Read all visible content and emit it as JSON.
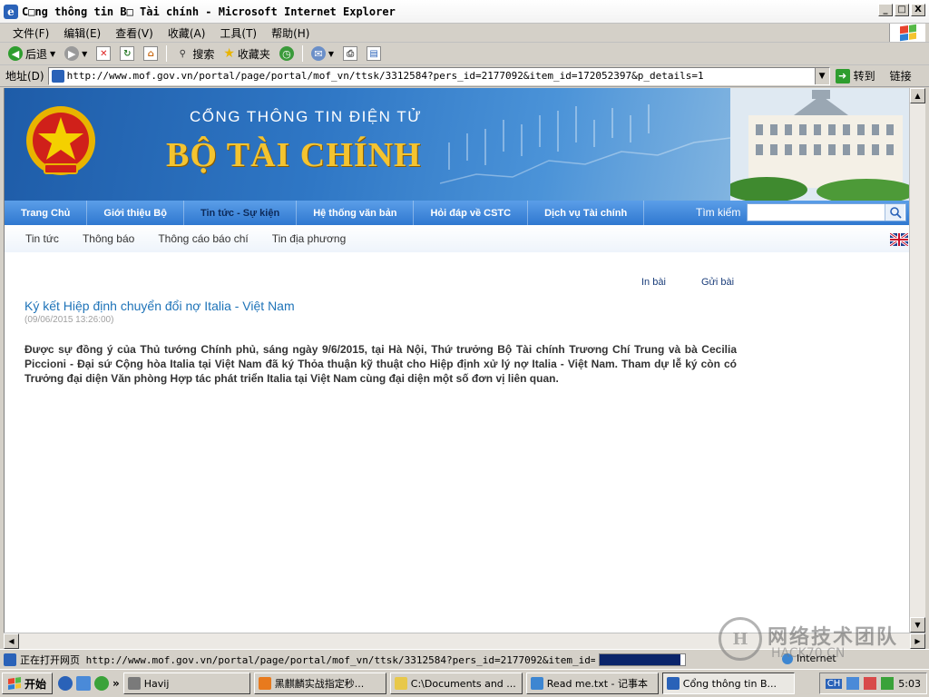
{
  "window": {
    "title": "C□ng thông tin B□ Tài chính - Microsoft Internet Explorer",
    "controls": {
      "minimize": "_",
      "maximize": "□",
      "close": "X"
    }
  },
  "menu": [
    "文件(F)",
    "编辑(E)",
    "查看(V)",
    "收藏(A)",
    "工具(T)",
    "帮助(H)"
  ],
  "toolbar": {
    "back": "后退",
    "search": "搜索",
    "favorites": "收藏夹"
  },
  "address": {
    "label": "地址(D)",
    "url": "http://www.mof.gov.vn/portal/page/portal/mof_vn/ttsk/3312584?pers_id=2177092&item_id=172052397&p_details=1",
    "go": "转到",
    "links": "链接"
  },
  "banner": {
    "subtitle": "CỔNG THÔNG TIN ĐIỆN TỬ",
    "title": "BỘ TÀI CHÍNH"
  },
  "nav": {
    "items": [
      {
        "label": "Trang Chủ",
        "active": false
      },
      {
        "label": "Giới thiệu Bộ",
        "active": false
      },
      {
        "label": "Tin tức - Sự kiện",
        "active": true
      },
      {
        "label": "Hệ thống văn bản",
        "active": false
      },
      {
        "label": "Hỏi đáp về CSTC",
        "active": false
      },
      {
        "label": "Dịch vụ Tài chính",
        "active": false
      }
    ],
    "search_label": "Tìm kiếm"
  },
  "subnav": [
    "Tin tức",
    "Thông báo",
    "Thông cáo báo chí",
    "Tin địa phương"
  ],
  "article": {
    "print": "In bài",
    "send": "Gửi bài",
    "title": "Ký kết Hiệp định chuyển đổi nợ Italia - Việt Nam",
    "date": "(09/06/2015 13:26:00)",
    "body": "Được sự đồng ý của Thủ tướng Chính phủ, sáng ngày 9/6/2015, tại Hà Nội, Thứ trưởng Bộ Tài chính Trương Chí Trung và bà Cecilia Piccioni - Đại sứ Cộng hòa Italia tại Việt Nam đã ký Thỏa thuận kỹ thuật cho Hiệp định xử lý nợ Italia - Việt Nam. Tham dự lễ ký còn có Trưởng đại diện Văn phòng Hợp tác phát triển Italia tại Việt Nam cùng đại diện một số đơn vị liên quan."
  },
  "status": {
    "text": "正在打开网页 http://www.mof.gov.vn/portal/page/portal/mof_vn/ttsk/3312584?pers_id=2177092&item_id=1720",
    "progress": 0.95,
    "zone": "Internet"
  },
  "watermark": {
    "mark": "H",
    "text": "网络技术团队",
    "sub": "HACK70.CN"
  },
  "taskbar": {
    "start": "开始",
    "tasks": [
      {
        "label": "Havij",
        "color": "#7a7a7a",
        "active": false
      },
      {
        "label": "黑麒麟实战指定秒...",
        "color": "#e87a1d",
        "active": false
      },
      {
        "label": "C:\\Documents and ...",
        "color": "#e8c84a",
        "active": false
      },
      {
        "label": "Read me.txt - 记事本",
        "color": "#3d86d1",
        "active": false
      },
      {
        "label": "Cổng thông tin B...",
        "color": "#2a62b8",
        "active": true
      }
    ],
    "lang": "CH",
    "clock": "5:03"
  }
}
